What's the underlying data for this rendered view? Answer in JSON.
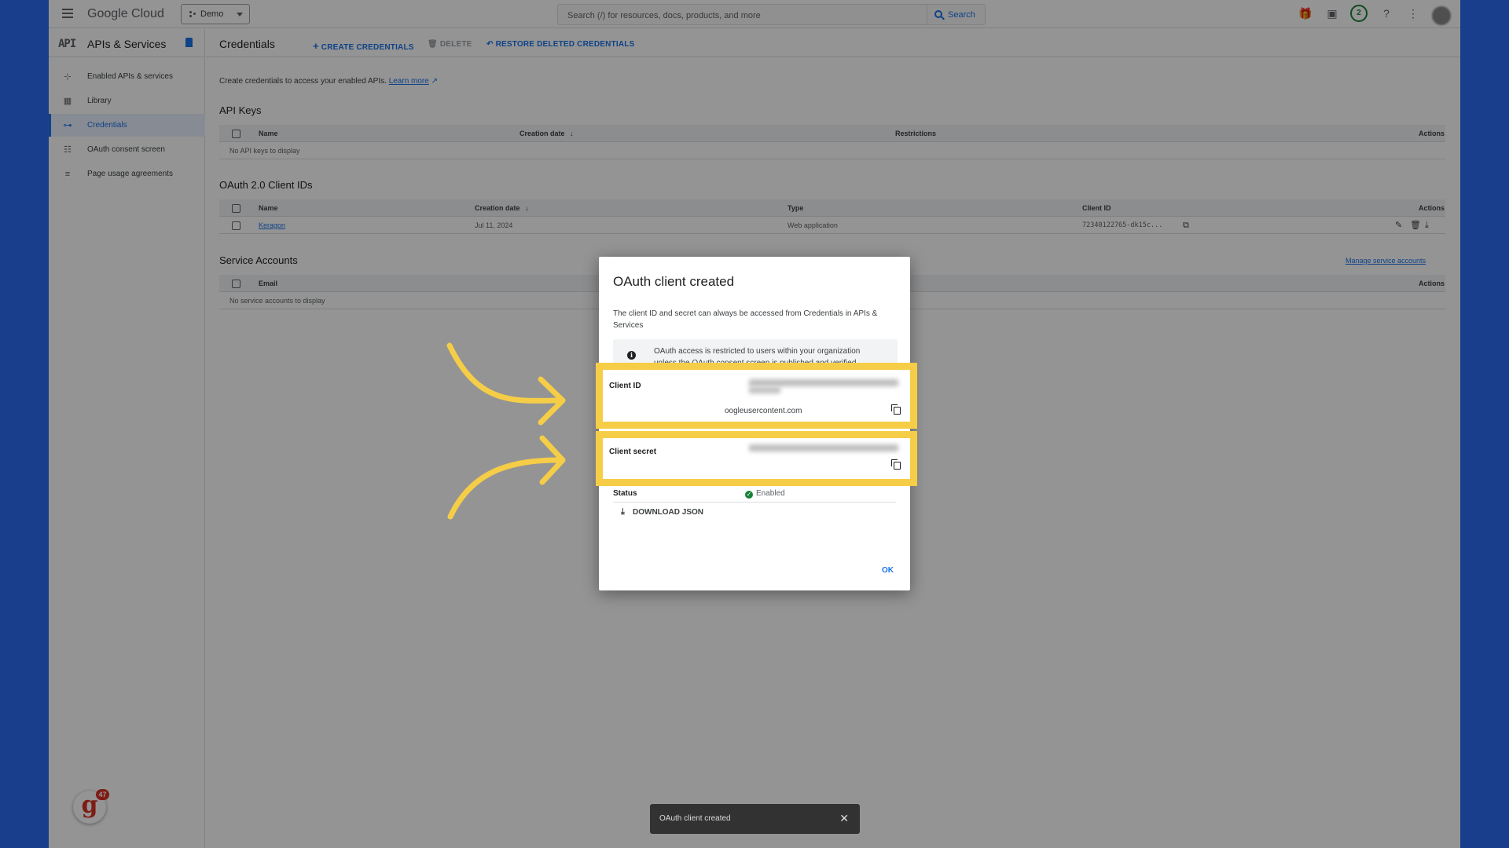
{
  "topbar": {
    "brand": "Google Cloud",
    "project": "Demo",
    "search_placeholder": "Search (/) for resources, docs, products, and more",
    "search_button": "Search",
    "notifications_count": "2"
  },
  "sidebar": {
    "api_badge": "API",
    "title": "APIs & Services",
    "items": [
      {
        "label": "Enabled APIs & services",
        "icon": "hub-icon"
      },
      {
        "label": "Library",
        "icon": "library-icon"
      },
      {
        "label": "Credentials",
        "icon": "key-icon"
      },
      {
        "label": "OAuth consent screen",
        "icon": "consent-icon"
      },
      {
        "label": "Page usage agreements",
        "icon": "settings-list-icon"
      }
    ],
    "extension_badge_count": "47"
  },
  "main": {
    "title": "Credentials",
    "actions": {
      "create": "CREATE CREDENTIALS",
      "delete": "DELETE",
      "restore": "RESTORE DELETED CREDENTIALS"
    },
    "description": "Create credentials to access your enabled APIs.",
    "learn_more": "Learn more",
    "api_keys": {
      "title": "API Keys",
      "columns": [
        "Name",
        "Creation date",
        "Restrictions",
        "Actions"
      ],
      "empty": "No API keys to display"
    },
    "oauth": {
      "title": "OAuth 2.0 Client IDs",
      "columns": [
        "Name",
        "Creation date",
        "Type",
        "Client ID",
        "Actions"
      ],
      "rows": [
        {
          "name": "Keragon",
          "date": "Jul 11, 2024",
          "type": "Web application",
          "client_id": "72340122765-dk15c..."
        }
      ]
    },
    "service_accounts": {
      "title": "Service Accounts",
      "manage_link": "Manage service accounts",
      "columns": [
        "Email",
        "Actions"
      ],
      "empty": "No service accounts to display"
    }
  },
  "dialog": {
    "title": "OAuth client created",
    "description": "The client ID and secret can always be accessed from Credentials in APIs & Services",
    "info": "OAuth access is restricted to users within your organization unless the OAuth consent screen is published and verified.",
    "client_id_label": "Client ID",
    "client_id_suffix": "oogleusercontent.com",
    "client_secret_label": "Client secret",
    "status_label": "Status",
    "status_value": "Enabled",
    "download_button": "DOWNLOAD JSON",
    "ok_button": "OK"
  },
  "toast": {
    "message": "OAuth client created"
  },
  "colors": {
    "highlight": "#f5cd47",
    "accent": "#1a73e8",
    "background": "#2b6bf1"
  }
}
